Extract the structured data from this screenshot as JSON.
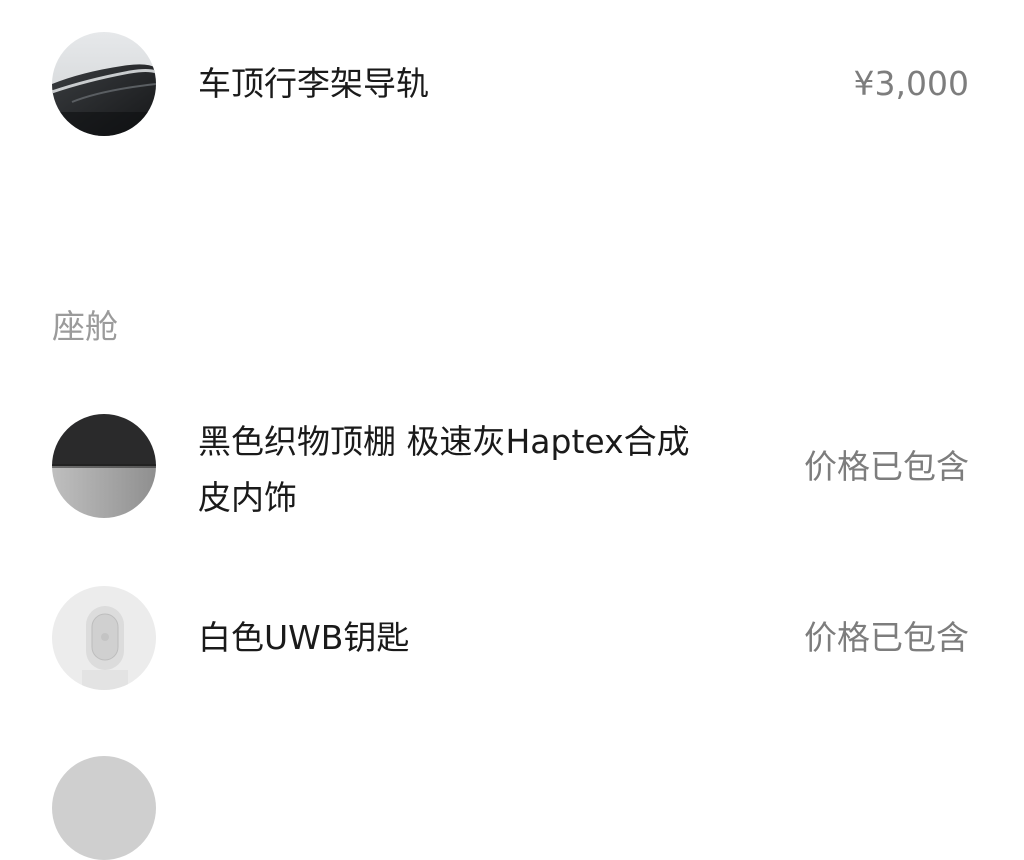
{
  "exterior_items": [
    {
      "name": "车顶行李架导轨",
      "price": "¥3,000",
      "thumb_icon": "roof-rail-icon"
    }
  ],
  "cabin": {
    "section_title": "座舱",
    "items": [
      {
        "name_line1": "黑色织物顶棚 极速灰Haptex合成",
        "name_line2": "皮内饰",
        "price": "价格已包含",
        "thumb_icon": "interior-trim-icon"
      },
      {
        "name": "白色UWB钥匙",
        "price": "价格已包含",
        "thumb_icon": "uwb-key-icon"
      }
    ]
  },
  "colors": {
    "text_primary": "#1a1a1a",
    "text_secondary": "#7d7d7d",
    "section_label": "#9b9b9b",
    "background": "#ffffff"
  }
}
